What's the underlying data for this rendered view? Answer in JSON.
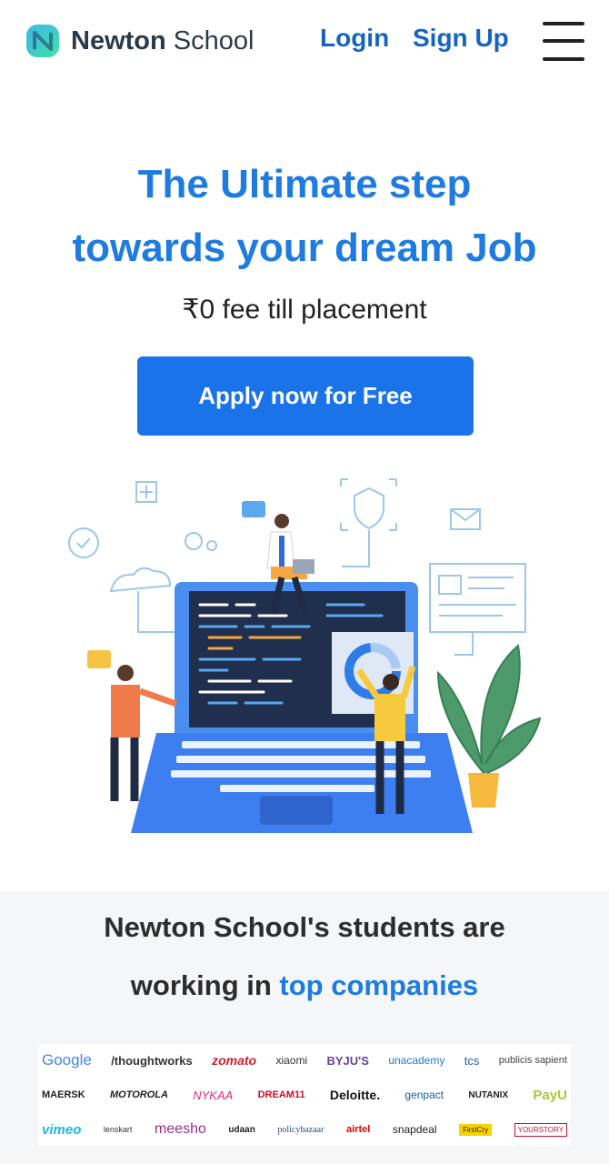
{
  "header": {
    "brand_bold": "Newton",
    "brand_light": " School",
    "login_label": "Login",
    "signup_label": "Sign Up"
  },
  "hero": {
    "title_line1": "The Ultimate step",
    "title_line2": "towards your dream Job",
    "subtitle": "₹0 fee till placement",
    "cta_label": "Apply now for Free"
  },
  "companies": {
    "title_line1": "Newton School's students are",
    "title_line2_prefix": "working in ",
    "title_line2_highlight": "top companies",
    "logos_row1": [
      "Google",
      "/thoughtworks",
      "zomato",
      "xiaomi",
      "BYJU'S",
      "unacademy",
      "tcs",
      "publicis sapient"
    ],
    "logos_row2": [
      "MAERSK",
      "MOTOROLA",
      "NYKAA",
      "DREAM11",
      "Deloitte.",
      "genpact",
      "NUTANIX",
      "PayU"
    ],
    "logos_row3": [
      "vimeo",
      "lenskart",
      "meesho",
      "udaan",
      "policybazaar",
      "airtel",
      "snapdeal",
      "FirstCry",
      "YOURSTORY"
    ]
  },
  "colors": {
    "brand_blue": "#1e7be0",
    "cta_blue": "#1a73e8",
    "nav_blue": "#1565c0",
    "section_bg": "#f5f6f8"
  }
}
